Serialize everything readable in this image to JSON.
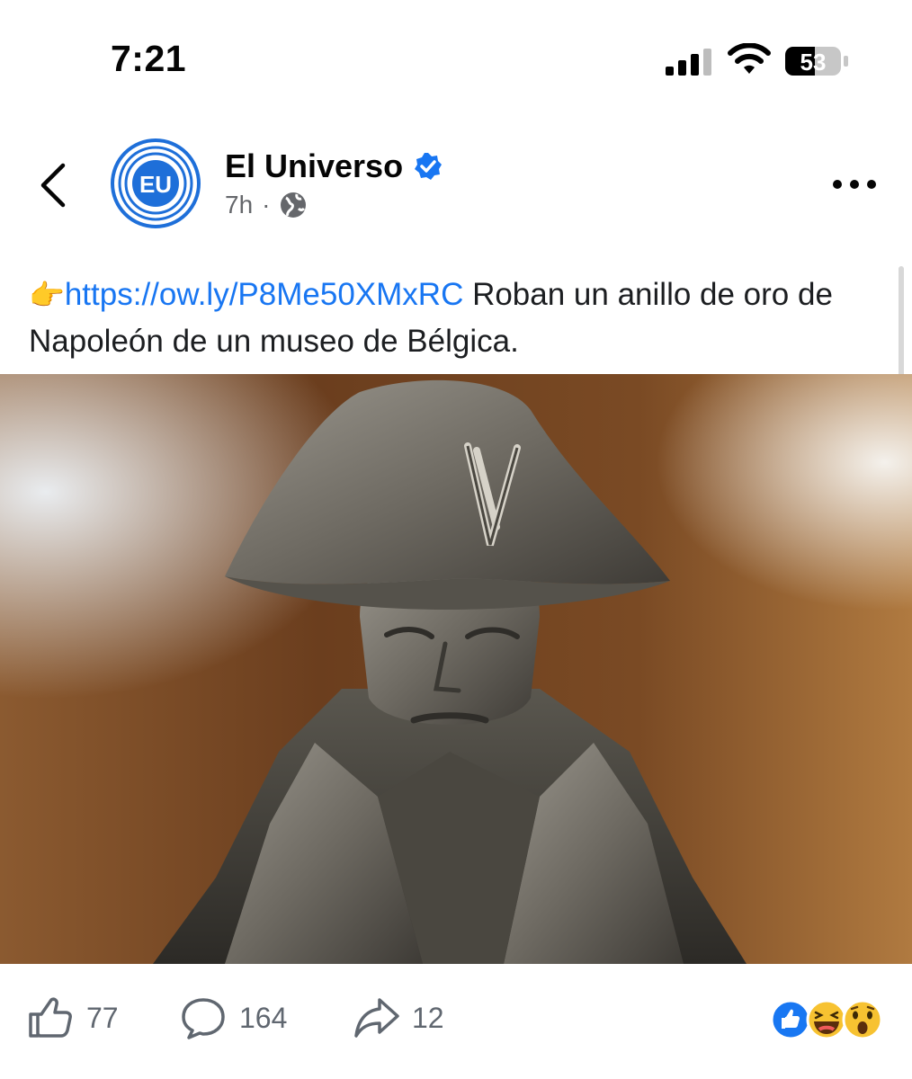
{
  "status_bar": {
    "time": "7:21",
    "battery_level": "53"
  },
  "header": {
    "page_name": "El Universo",
    "avatar_initials": "EU",
    "timestamp": "7h",
    "separator": "·",
    "verified": true,
    "icons": [
      "back-chevron-icon",
      "verified-badge-icon",
      "globe-icon",
      "more-options-icon"
    ]
  },
  "post": {
    "emoji": "👉",
    "link": "https://ow.ly/P8Me50XMxRC",
    "text": " Roban un anillo de oro de Napoleón de un museo de Bélgica.",
    "image_alt": "pewter Napoleon figurine photo"
  },
  "actions": {
    "like_count": "77",
    "comment_count": "164",
    "share_count": "12",
    "reactions": [
      "like",
      "haha",
      "wow"
    ]
  },
  "colors": {
    "accent": "#1876f2",
    "meta_gray": "#65676b",
    "avatar_blue": "#1e6fd9"
  }
}
